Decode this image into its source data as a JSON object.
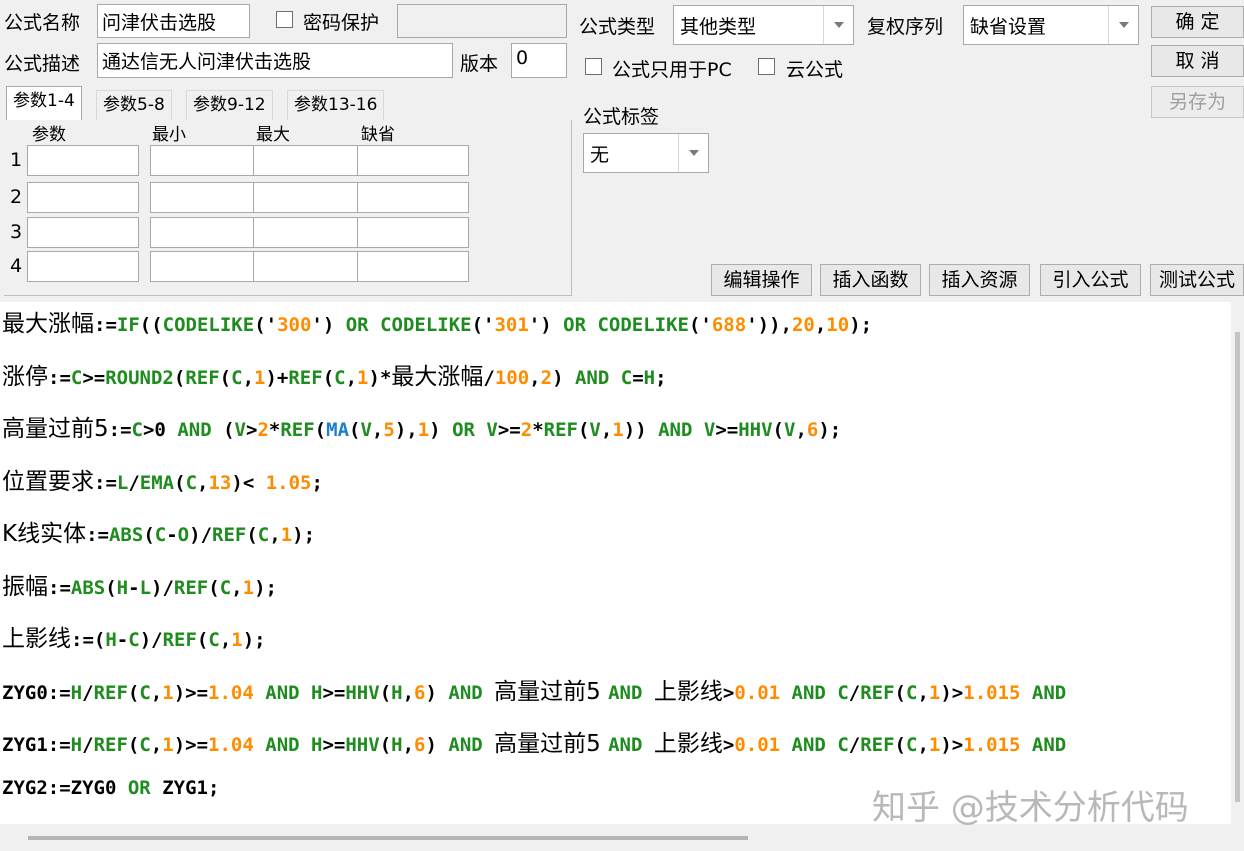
{
  "header": {
    "name_label": "公式名称",
    "name_value": "问津伏击选股",
    "password_label": "密码保护",
    "password_value": "",
    "desc_label": "公式描述",
    "desc_value": "通达信无人问津伏击选股",
    "version_label": "版本",
    "version_value": "0",
    "type_label": "公式类型",
    "type_value": "其他类型",
    "rights_label": "复权序列",
    "rights_value": "缺省设置",
    "pc_only_label": "公式只用于PC",
    "cloud_label": "云公式",
    "tag_label": "公式标签",
    "tag_value": "无"
  },
  "buttons": {
    "ok": "确  定",
    "cancel": "取  消",
    "save_as": "另存为",
    "edit_ops": "编辑操作",
    "insert_func": "插入函数",
    "insert_res": "插入资源",
    "import_formula": "引入公式",
    "test_formula": "测试公式"
  },
  "tabs": [
    "参数1-4",
    "参数5-8",
    "参数9-12",
    "参数13-16"
  ],
  "param_table": {
    "columns": [
      "参数",
      "最小",
      "最大",
      "缺省"
    ],
    "rows": [
      "1",
      "2",
      "3",
      "4"
    ]
  },
  "code_lines": [
    [
      [
        "最大涨幅",
        "zh"
      ],
      [
        ":=",
        "k"
      ],
      [
        "IF",
        "g"
      ],
      [
        "((",
        "k"
      ],
      [
        "CODELIKE",
        "g"
      ],
      [
        "('",
        "k"
      ],
      [
        "300",
        "o"
      ],
      [
        "') ",
        "k"
      ],
      [
        "OR ",
        "g"
      ],
      [
        "CODELIKE",
        "g"
      ],
      [
        "('",
        "k"
      ],
      [
        "301",
        "o"
      ],
      [
        "') ",
        "k"
      ],
      [
        "OR ",
        "g"
      ],
      [
        "CODELIKE",
        "g"
      ],
      [
        "('",
        "k"
      ],
      [
        "688",
        "o"
      ],
      [
        "')),",
        "k"
      ],
      [
        "20",
        "o"
      ],
      [
        ",",
        "k"
      ],
      [
        "10",
        "o"
      ],
      [
        ");",
        "k"
      ]
    ],
    [
      [
        "涨停",
        "zh"
      ],
      [
        ":=",
        "k"
      ],
      [
        "C",
        "g"
      ],
      [
        ">=",
        "k"
      ],
      [
        "ROUND2",
        "g"
      ],
      [
        "(",
        "k"
      ],
      [
        "REF",
        "g"
      ],
      [
        "(",
        "k"
      ],
      [
        "C",
        "g"
      ],
      [
        ",",
        "k"
      ],
      [
        "1",
        "o"
      ],
      [
        ")+",
        "k"
      ],
      [
        "REF",
        "g"
      ],
      [
        "(",
        "k"
      ],
      [
        "C",
        "g"
      ],
      [
        ",",
        "k"
      ],
      [
        "1",
        "o"
      ],
      [
        ")*",
        "k"
      ],
      [
        "最大涨幅",
        "zh"
      ],
      [
        "/",
        "k"
      ],
      [
        "100",
        "o"
      ],
      [
        ",",
        "k"
      ],
      [
        "2",
        "o"
      ],
      [
        ") ",
        "k"
      ],
      [
        "AND ",
        "g"
      ],
      [
        "C",
        "g"
      ],
      [
        "=",
        "k"
      ],
      [
        "H",
        "g"
      ],
      [
        ";",
        "k"
      ]
    ],
    [
      [
        "高量过前5",
        "zh"
      ],
      [
        ":=",
        "k"
      ],
      [
        "C",
        "g"
      ],
      [
        ">0 ",
        "k"
      ],
      [
        "AND ",
        "g"
      ],
      [
        "(",
        "k"
      ],
      [
        "V",
        "g"
      ],
      [
        ">",
        "k"
      ],
      [
        "2",
        "o"
      ],
      [
        "*",
        "k"
      ],
      [
        "REF",
        "g"
      ],
      [
        "(",
        "k"
      ],
      [
        "MA",
        "b"
      ],
      [
        "(",
        "k"
      ],
      [
        "V",
        "g"
      ],
      [
        ",",
        "k"
      ],
      [
        "5",
        "o"
      ],
      [
        "),",
        "k"
      ],
      [
        "1",
        "o"
      ],
      [
        ") ",
        "k"
      ],
      [
        "OR ",
        "g"
      ],
      [
        "V",
        "g"
      ],
      [
        ">=",
        "k"
      ],
      [
        "2",
        "o"
      ],
      [
        "*",
        "k"
      ],
      [
        "REF",
        "g"
      ],
      [
        "(",
        "k"
      ],
      [
        "V",
        "g"
      ],
      [
        ",",
        "k"
      ],
      [
        "1",
        "o"
      ],
      [
        ")) ",
        "k"
      ],
      [
        "AND ",
        "g"
      ],
      [
        "V",
        "g"
      ],
      [
        ">=",
        "k"
      ],
      [
        "HHV",
        "g"
      ],
      [
        "(",
        "k"
      ],
      [
        "V",
        "g"
      ],
      [
        ",",
        "k"
      ],
      [
        "6",
        "o"
      ],
      [
        ");",
        "k"
      ]
    ],
    [
      [
        "位置要求",
        "zh"
      ],
      [
        ":=",
        "k"
      ],
      [
        "L",
        "g"
      ],
      [
        "/",
        "k"
      ],
      [
        "EMA",
        "g"
      ],
      [
        "(",
        "k"
      ],
      [
        "C",
        "g"
      ],
      [
        ",",
        "k"
      ],
      [
        "13",
        "o"
      ],
      [
        ")< ",
        "k"
      ],
      [
        "1.05",
        "o"
      ],
      [
        ";",
        "k"
      ]
    ],
    [
      [
        "K线实体",
        "zh"
      ],
      [
        ":=",
        "k"
      ],
      [
        "ABS",
        "g"
      ],
      [
        "(",
        "k"
      ],
      [
        "C",
        "g"
      ],
      [
        "-",
        "k"
      ],
      [
        "O",
        "g"
      ],
      [
        ")/",
        "k"
      ],
      [
        "REF",
        "g"
      ],
      [
        "(",
        "k"
      ],
      [
        "C",
        "g"
      ],
      [
        ",",
        "k"
      ],
      [
        "1",
        "o"
      ],
      [
        ");",
        "k"
      ]
    ],
    [
      [
        "振幅",
        "zh"
      ],
      [
        ":=",
        "k"
      ],
      [
        "ABS",
        "g"
      ],
      [
        "(",
        "k"
      ],
      [
        "H",
        "g"
      ],
      [
        "-",
        "k"
      ],
      [
        "L",
        "g"
      ],
      [
        ")/",
        "k"
      ],
      [
        "REF",
        "g"
      ],
      [
        "(",
        "k"
      ],
      [
        "C",
        "g"
      ],
      [
        ",",
        "k"
      ],
      [
        "1",
        "o"
      ],
      [
        ");",
        "k"
      ]
    ],
    [
      [
        "上影线",
        "zh"
      ],
      [
        ":=(",
        "k"
      ],
      [
        "H",
        "g"
      ],
      [
        "-",
        "k"
      ],
      [
        "C",
        "g"
      ],
      [
        ")/",
        "k"
      ],
      [
        "REF",
        "g"
      ],
      [
        "(",
        "k"
      ],
      [
        "C",
        "g"
      ],
      [
        ",",
        "k"
      ],
      [
        "1",
        "o"
      ],
      [
        ");",
        "k"
      ]
    ],
    [
      [
        "ZYG0",
        "k"
      ],
      [
        ":=",
        "k"
      ],
      [
        "H",
        "g"
      ],
      [
        "/",
        "k"
      ],
      [
        "REF",
        "g"
      ],
      [
        "(",
        "k"
      ],
      [
        "C",
        "g"
      ],
      [
        ",",
        "k"
      ],
      [
        "1",
        "o"
      ],
      [
        ")>=",
        "k"
      ],
      [
        "1.04",
        "o"
      ],
      [
        " ",
        "k"
      ],
      [
        "AND ",
        "g"
      ],
      [
        "H",
        "g"
      ],
      [
        ">=",
        "k"
      ],
      [
        "HHV",
        "g"
      ],
      [
        "(",
        "k"
      ],
      [
        "H",
        "g"
      ],
      [
        ",",
        "k"
      ],
      [
        "6",
        "o"
      ],
      [
        ") ",
        "k"
      ],
      [
        "AND ",
        "g"
      ],
      [
        "高量过前5 ",
        "zh"
      ],
      [
        "AND ",
        "g"
      ],
      [
        "上影线",
        "zh"
      ],
      [
        ">",
        "k"
      ],
      [
        "0.01",
        "o"
      ],
      [
        " ",
        "k"
      ],
      [
        "AND ",
        "g"
      ],
      [
        "C",
        "g"
      ],
      [
        "/",
        "k"
      ],
      [
        "REF",
        "g"
      ],
      [
        "(",
        "k"
      ],
      [
        "C",
        "g"
      ],
      [
        ",",
        "k"
      ],
      [
        "1",
        "o"
      ],
      [
        ")>",
        "k"
      ],
      [
        "1.015",
        "o"
      ],
      [
        " ",
        "k"
      ],
      [
        "AND",
        "g"
      ]
    ],
    [
      [
        "ZYG1",
        "k"
      ],
      [
        ":=",
        "k"
      ],
      [
        "H",
        "g"
      ],
      [
        "/",
        "k"
      ],
      [
        "REF",
        "g"
      ],
      [
        "(",
        "k"
      ],
      [
        "C",
        "g"
      ],
      [
        ",",
        "k"
      ],
      [
        "1",
        "o"
      ],
      [
        ")>=",
        "k"
      ],
      [
        "1.04",
        "o"
      ],
      [
        " ",
        "k"
      ],
      [
        "AND ",
        "g"
      ],
      [
        "H",
        "g"
      ],
      [
        ">=",
        "k"
      ],
      [
        "HHV",
        "g"
      ],
      [
        "(",
        "k"
      ],
      [
        "H",
        "g"
      ],
      [
        ",",
        "k"
      ],
      [
        "6",
        "o"
      ],
      [
        ") ",
        "k"
      ],
      [
        "AND ",
        "g"
      ],
      [
        "高量过前5 ",
        "zh"
      ],
      [
        "AND ",
        "g"
      ],
      [
        "上影线",
        "zh"
      ],
      [
        ">",
        "k"
      ],
      [
        "0.01",
        "o"
      ],
      [
        " ",
        "k"
      ],
      [
        "AND ",
        "g"
      ],
      [
        "C",
        "g"
      ],
      [
        "/",
        "k"
      ],
      [
        "REF",
        "g"
      ],
      [
        "(",
        "k"
      ],
      [
        "C",
        "g"
      ],
      [
        ",",
        "k"
      ],
      [
        "1",
        "o"
      ],
      [
        ")>",
        "k"
      ],
      [
        "1.015",
        "o"
      ],
      [
        " ",
        "k"
      ],
      [
        "AND",
        "g"
      ]
    ],
    [
      [
        "ZYG2",
        "k"
      ],
      [
        ":=",
        "k"
      ],
      [
        "ZYG0 ",
        "k"
      ],
      [
        "OR ",
        "g"
      ],
      [
        "ZYG1",
        "k"
      ],
      [
        ";",
        "k"
      ]
    ]
  ],
  "code_colors": {
    "k": "#000000",
    "g": "#1f8c1f",
    "o": "#ff8c00",
    "b": "#1e7ec8",
    "zh": "#000000"
  },
  "watermark": "知乎 @技术分析代码"
}
